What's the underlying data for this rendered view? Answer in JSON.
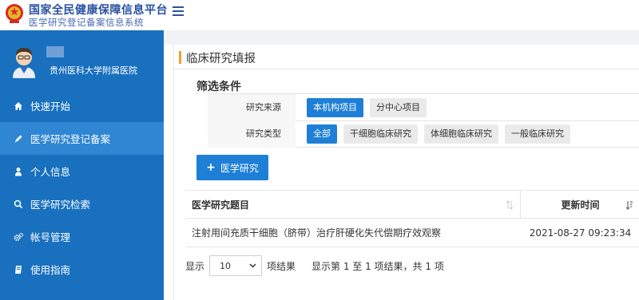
{
  "header": {
    "title": "国家全民健康保障信息平台",
    "subtitle": "医学研究登记备案信息系统"
  },
  "user": {
    "org": "贵州医科大学附属医院"
  },
  "sidebar": {
    "items": [
      {
        "label": "快速开始",
        "icon": "home-icon",
        "active": false
      },
      {
        "label": "医学研究登记备案",
        "icon": "pencil-icon",
        "active": true
      },
      {
        "label": "个人信息",
        "icon": "user-icon",
        "active": false
      },
      {
        "label": "医学研究检索",
        "icon": "search-icon",
        "active": false
      },
      {
        "label": "帐号管理",
        "icon": "gears-icon",
        "active": false
      },
      {
        "label": "使用指南",
        "icon": "book-icon",
        "active": false
      }
    ]
  },
  "main": {
    "heading": "临床研究填报",
    "filter_title": "筛选条件",
    "filters": [
      {
        "label": "研究来源",
        "options": [
          {
            "label": "本机构项目",
            "selected": true
          },
          {
            "label": "分中心项目",
            "selected": false
          }
        ]
      },
      {
        "label": "研究类型",
        "options": [
          {
            "label": "全部",
            "selected": true
          },
          {
            "label": "干细胞临床研究",
            "selected": false
          },
          {
            "label": "体细胞临床研究",
            "selected": false
          },
          {
            "label": "一般临床研究",
            "selected": false
          }
        ]
      }
    ],
    "add_button": "医学研究",
    "table": {
      "columns": [
        "医学研究题目",
        "更新时间"
      ],
      "rows": [
        [
          "注射用间充质干细胞（脐带）治疗肝硬化失代偿期疗效观察",
          "2021-08-27 09:23:34"
        ]
      ]
    },
    "pager": {
      "show_label": "显示",
      "page_size": "10",
      "suffix": "项结果",
      "info": "显示第 1 至 1 项结果，共 1 项"
    }
  },
  "colors": {
    "sidebar": "#1870be",
    "sidebar_active": "#2f86d2",
    "primary": "#1e7fd6",
    "brand_text": "#2a52a3",
    "heading_accent": "#f0a030"
  }
}
